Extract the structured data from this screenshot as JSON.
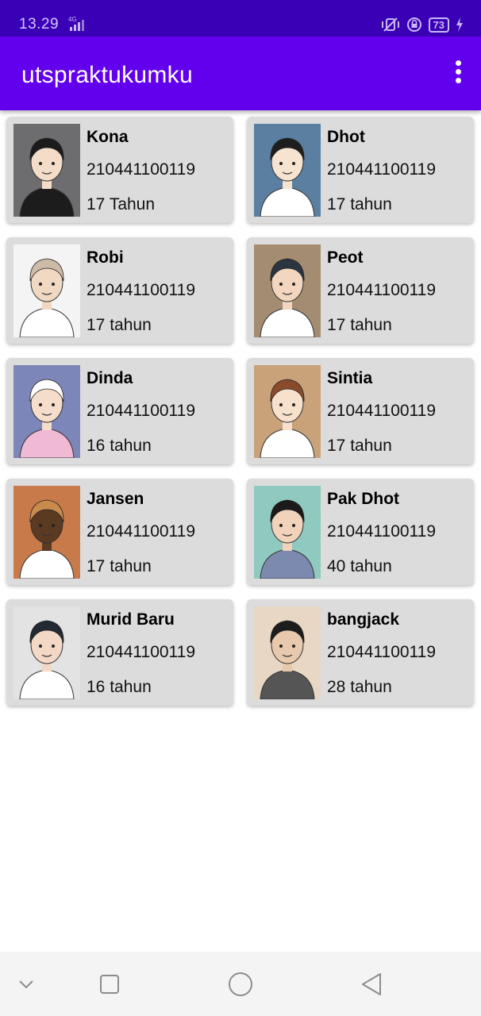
{
  "status_bar": {
    "time": "13.29",
    "network": "4G",
    "battery": "73"
  },
  "app_bar": {
    "title": "utspraktukumku",
    "menu_icon": "more-vert-icon"
  },
  "colors": {
    "status_bar": "#3a00b5",
    "app_bar": "#6200ee",
    "card": "#dcdcdc"
  },
  "students": [
    {
      "name": "Kona",
      "nim": "210441100119",
      "age": "17 Tahun",
      "avatar": {
        "bg": "#6d6d70",
        "skin": "#f3dcc8",
        "hair": "#1b1b1b",
        "shirt": "#1c1c1c"
      }
    },
    {
      "name": "Dhot",
      "nim": "210441100119",
      "age": "17 tahun",
      "avatar": {
        "bg": "#5a7fa0",
        "skin": "#f6e3d0",
        "hair": "#1e1e1e",
        "shirt": "#ffffff"
      }
    },
    {
      "name": "Robi",
      "nim": "210441100119",
      "age": "17 tahun",
      "avatar": {
        "bg": "#f4f4f4",
        "skin": "#f1d8c2",
        "hair": "#cdbba8",
        "shirt": "#ffffff"
      }
    },
    {
      "name": "Peot",
      "nim": "210441100119",
      "age": "17 tahun",
      "avatar": {
        "bg": "#a48c72",
        "skin": "#f2d6bf",
        "hair": "#2b3540",
        "shirt": "#ffffff"
      }
    },
    {
      "name": "Dinda",
      "nim": "210441100119",
      "age": "16 tahun",
      "avatar": {
        "bg": "#7d86b8",
        "skin": "#f5dccb",
        "hair": "#ffffff",
        "shirt": "#f0b9d4"
      }
    },
    {
      "name": "Sintia",
      "nim": "210441100119",
      "age": "17 tahun",
      "avatar": {
        "bg": "#c9a27a",
        "skin": "#f7e0cc",
        "hair": "#8a4b2b",
        "shirt": "#ffffff"
      }
    },
    {
      "name": "Jansen",
      "nim": "210441100119",
      "age": "17 tahun",
      "avatar": {
        "bg": "#c97a4a",
        "skin": "#5b3a22",
        "hair": "#c98a4d",
        "shirt": "#ffffff"
      }
    },
    {
      "name": "Pak Dhot",
      "nim": "210441100119",
      "age": "40 tahun",
      "avatar": {
        "bg": "#8fc9c0",
        "skin": "#f1d2bb",
        "hair": "#1a1a1a",
        "shirt": "#7d8ab0"
      }
    },
    {
      "name": "Murid Baru",
      "nim": "210441100119",
      "age": "16 tahun",
      "avatar": {
        "bg": "#e3e3e3",
        "skin": "#f3d8c5",
        "hair": "#222a33",
        "shirt": "#ffffff"
      }
    },
    {
      "name": "bangjack",
      "nim": "210441100119",
      "age": "28 tahun",
      "avatar": {
        "bg": "#e8d7c4",
        "skin": "#e9c9ad",
        "hair": "#1d1d1d",
        "shirt": "#555555"
      }
    }
  ],
  "nav_bar": {
    "icons": [
      "chevron-down-icon",
      "recents-square-icon",
      "home-circle-icon",
      "back-triangle-icon"
    ]
  }
}
